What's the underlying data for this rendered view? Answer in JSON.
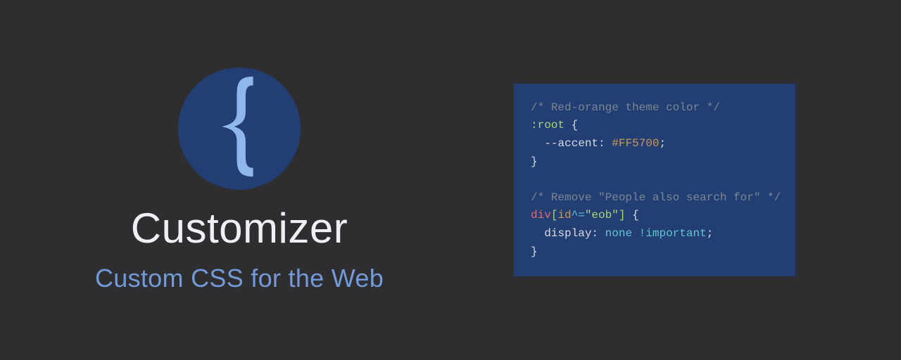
{
  "hero": {
    "title": "Customizer",
    "subtitle": "Custom CSS for the Web",
    "logo_glyph": "brace-left"
  },
  "code": {
    "comment1": "/* Red-orange theme color */",
    "selector1": ":root",
    "prop1": "--accent",
    "value1": "#FF5700",
    "comment2": "/* Remove \"People also search for\" */",
    "tag2": "div",
    "attr2": "id",
    "op2": "^=",
    "str2": "\"eob\"",
    "prop2": "display",
    "value2": "none",
    "imp2": "!important"
  }
}
